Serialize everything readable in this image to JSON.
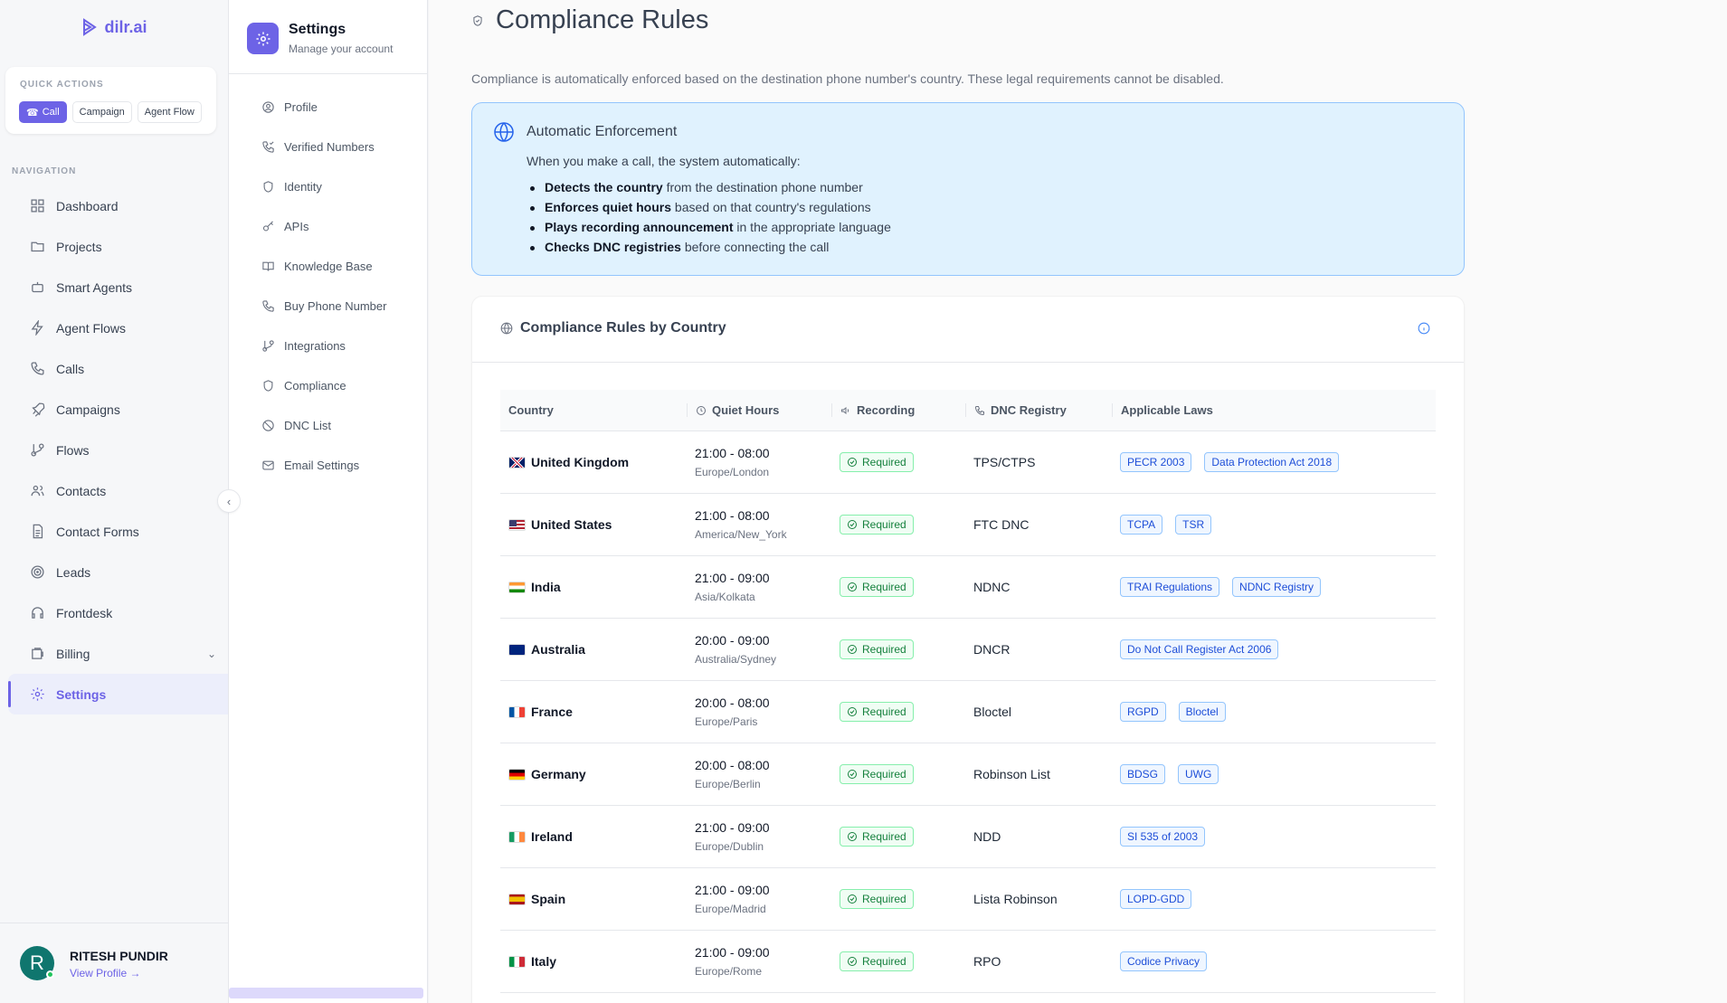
{
  "brand": {
    "name": "dilr.ai",
    "color": "#6d63e6"
  },
  "quick_actions": {
    "title": "QUICK ACTIONS",
    "buttons": [
      "Call",
      "Campaign",
      "Agent Flow"
    ]
  },
  "navigation": {
    "title": "NAVIGATION",
    "items": [
      {
        "label": "Dashboard",
        "icon": "dashboard-icon"
      },
      {
        "label": "Projects",
        "icon": "folder-icon"
      },
      {
        "label": "Smart Agents",
        "icon": "bot-icon"
      },
      {
        "label": "Agent Flows",
        "icon": "lightning-icon"
      },
      {
        "label": "Calls",
        "icon": "phone-icon"
      },
      {
        "label": "Campaigns",
        "icon": "rocket-icon"
      },
      {
        "label": "Flows",
        "icon": "flow-icon"
      },
      {
        "label": "Contacts",
        "icon": "users-icon"
      },
      {
        "label": "Contact Forms",
        "icon": "document-icon"
      },
      {
        "label": "Leads",
        "icon": "target-icon"
      },
      {
        "label": "Frontdesk",
        "icon": "headphones-icon"
      },
      {
        "label": "Billing",
        "icon": "wallet-icon"
      },
      {
        "label": "Settings",
        "icon": "gear-icon",
        "active": true
      }
    ]
  },
  "profile": {
    "initial": "R",
    "name": "RITESH PUNDIR",
    "link": "View Profile →"
  },
  "settings_nav": {
    "title": "Settings",
    "subtitle": "Manage your account",
    "items": [
      {
        "label": "Profile",
        "icon": "user-icon"
      },
      {
        "label": "Verified Numbers",
        "icon": "phone-check-icon"
      },
      {
        "label": "Identity",
        "icon": "shield-icon"
      },
      {
        "label": "APIs",
        "icon": "key-icon"
      },
      {
        "label": "Knowledge Base",
        "icon": "book-icon"
      },
      {
        "label": "Buy Phone Number",
        "icon": "phone-icon"
      },
      {
        "label": "Integrations",
        "icon": "plug-icon"
      },
      {
        "label": "Compliance",
        "icon": "shield-icon"
      },
      {
        "label": "DNC List",
        "icon": "ban-icon"
      },
      {
        "label": "Email Settings",
        "icon": "mail-icon"
      }
    ]
  },
  "main": {
    "title": "Compliance Rules",
    "description": "Compliance is automatically enforced based on the destination phone number's country. These legal requirements cannot be disabled.",
    "auto": {
      "title": "Automatic Enforcement",
      "intro": "When you make a call, the system automatically:",
      "items": [
        {
          "bold": "Detects the country",
          "rest": " from the destination phone number"
        },
        {
          "bold": "Enforces quiet hours",
          "rest": " based on that country's regulations"
        },
        {
          "bold": "Plays recording announcement",
          "rest": " in the appropriate language"
        },
        {
          "bold": "Checks DNC registries",
          "rest": " before connecting the call"
        }
      ]
    },
    "table": {
      "title": "Compliance Rules by Country",
      "headers": [
        "Country",
        "Quiet Hours",
        "Recording",
        "DNC Registry",
        "Applicable Laws"
      ],
      "rows": [
        {
          "country": "United Kingdom",
          "flag": "uk",
          "time": "21:00 - 08:00",
          "tz": "Europe/London",
          "recording": "Required",
          "dnc": "TPS/CTPS",
          "laws": [
            "PECR 2003",
            "Data Protection Act 2018"
          ]
        },
        {
          "country": "United States",
          "flag": "us",
          "time": "21:00 - 08:00",
          "tz": "America/New_York",
          "recording": "Required",
          "dnc": "FTC DNC",
          "laws": [
            "TCPA",
            "TSR"
          ]
        },
        {
          "country": "India",
          "flag": "in",
          "time": "21:00 - 09:00",
          "tz": "Asia/Kolkata",
          "recording": "Required",
          "dnc": "NDNC",
          "laws": [
            "TRAI Regulations",
            "NDNC Registry"
          ]
        },
        {
          "country": "Australia",
          "flag": "au",
          "time": "20:00 - 09:00",
          "tz": "Australia/Sydney",
          "recording": "Required",
          "dnc": "DNCR",
          "laws": [
            "Do Not Call Register Act 2006"
          ]
        },
        {
          "country": "France",
          "flag": "fr",
          "time": "20:00 - 08:00",
          "tz": "Europe/Paris",
          "recording": "Required",
          "dnc": "Bloctel",
          "laws": [
            "RGPD",
            "Bloctel"
          ]
        },
        {
          "country": "Germany",
          "flag": "de",
          "time": "20:00 - 08:00",
          "tz": "Europe/Berlin",
          "recording": "Required",
          "dnc": "Robinson List",
          "laws": [
            "BDSG",
            "UWG"
          ]
        },
        {
          "country": "Ireland",
          "flag": "ie",
          "time": "21:00 - 09:00",
          "tz": "Europe/Dublin",
          "recording": "Required",
          "dnc": "NDD",
          "laws": [
            "SI 535 of 2003"
          ]
        },
        {
          "country": "Spain",
          "flag": "es",
          "time": "21:00 - 09:00",
          "tz": "Europe/Madrid",
          "recording": "Required",
          "dnc": "Lista Robinson",
          "laws": [
            "LOPD-GDD"
          ]
        },
        {
          "country": "Italy",
          "flag": "it",
          "time": "21:00 - 09:00",
          "tz": "Europe/Rome",
          "recording": "Required",
          "dnc": "RPO",
          "laws": [
            "Codice Privacy"
          ]
        }
      ]
    }
  }
}
